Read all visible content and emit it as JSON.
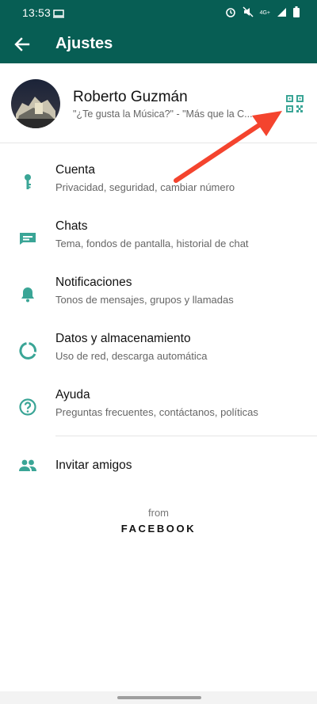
{
  "status_bar": {
    "time": "13:53",
    "signal_text": "4G+"
  },
  "app_bar": {
    "title": "Ajustes",
    "back_icon": "arrow-back-icon"
  },
  "profile": {
    "name": "Roberto Guzmán",
    "about": "\"¿Te gusta la Música?\" - \"Más que la C...",
    "qr_icon": "qr-code-icon"
  },
  "settings_items": [
    {
      "title": "Cuenta",
      "subtitle": "Privacidad, seguridad, cambiar número",
      "icon": "key-icon"
    },
    {
      "title": "Chats",
      "subtitle": "Tema, fondos de pantalla, historial de chat",
      "icon": "chat-icon"
    },
    {
      "title": "Notificaciones",
      "subtitle": "Tonos de mensajes, grupos y llamadas",
      "icon": "bell-icon"
    },
    {
      "title": "Datos y almacenamiento",
      "subtitle": "Uso de red, descarga automática",
      "icon": "data-usage-icon"
    },
    {
      "title": "Ayuda",
      "subtitle": "Preguntas frecuentes, contáctanos, políticas",
      "icon": "help-icon"
    }
  ],
  "invite": {
    "label": "Invitar amigos",
    "icon": "people-icon"
  },
  "footer": {
    "from": "from",
    "brand": "FACEBOOK"
  },
  "colors": {
    "primary_dark": "#075E54",
    "icon_teal": "#3AA596",
    "annotation_arrow": "#F4442E"
  }
}
